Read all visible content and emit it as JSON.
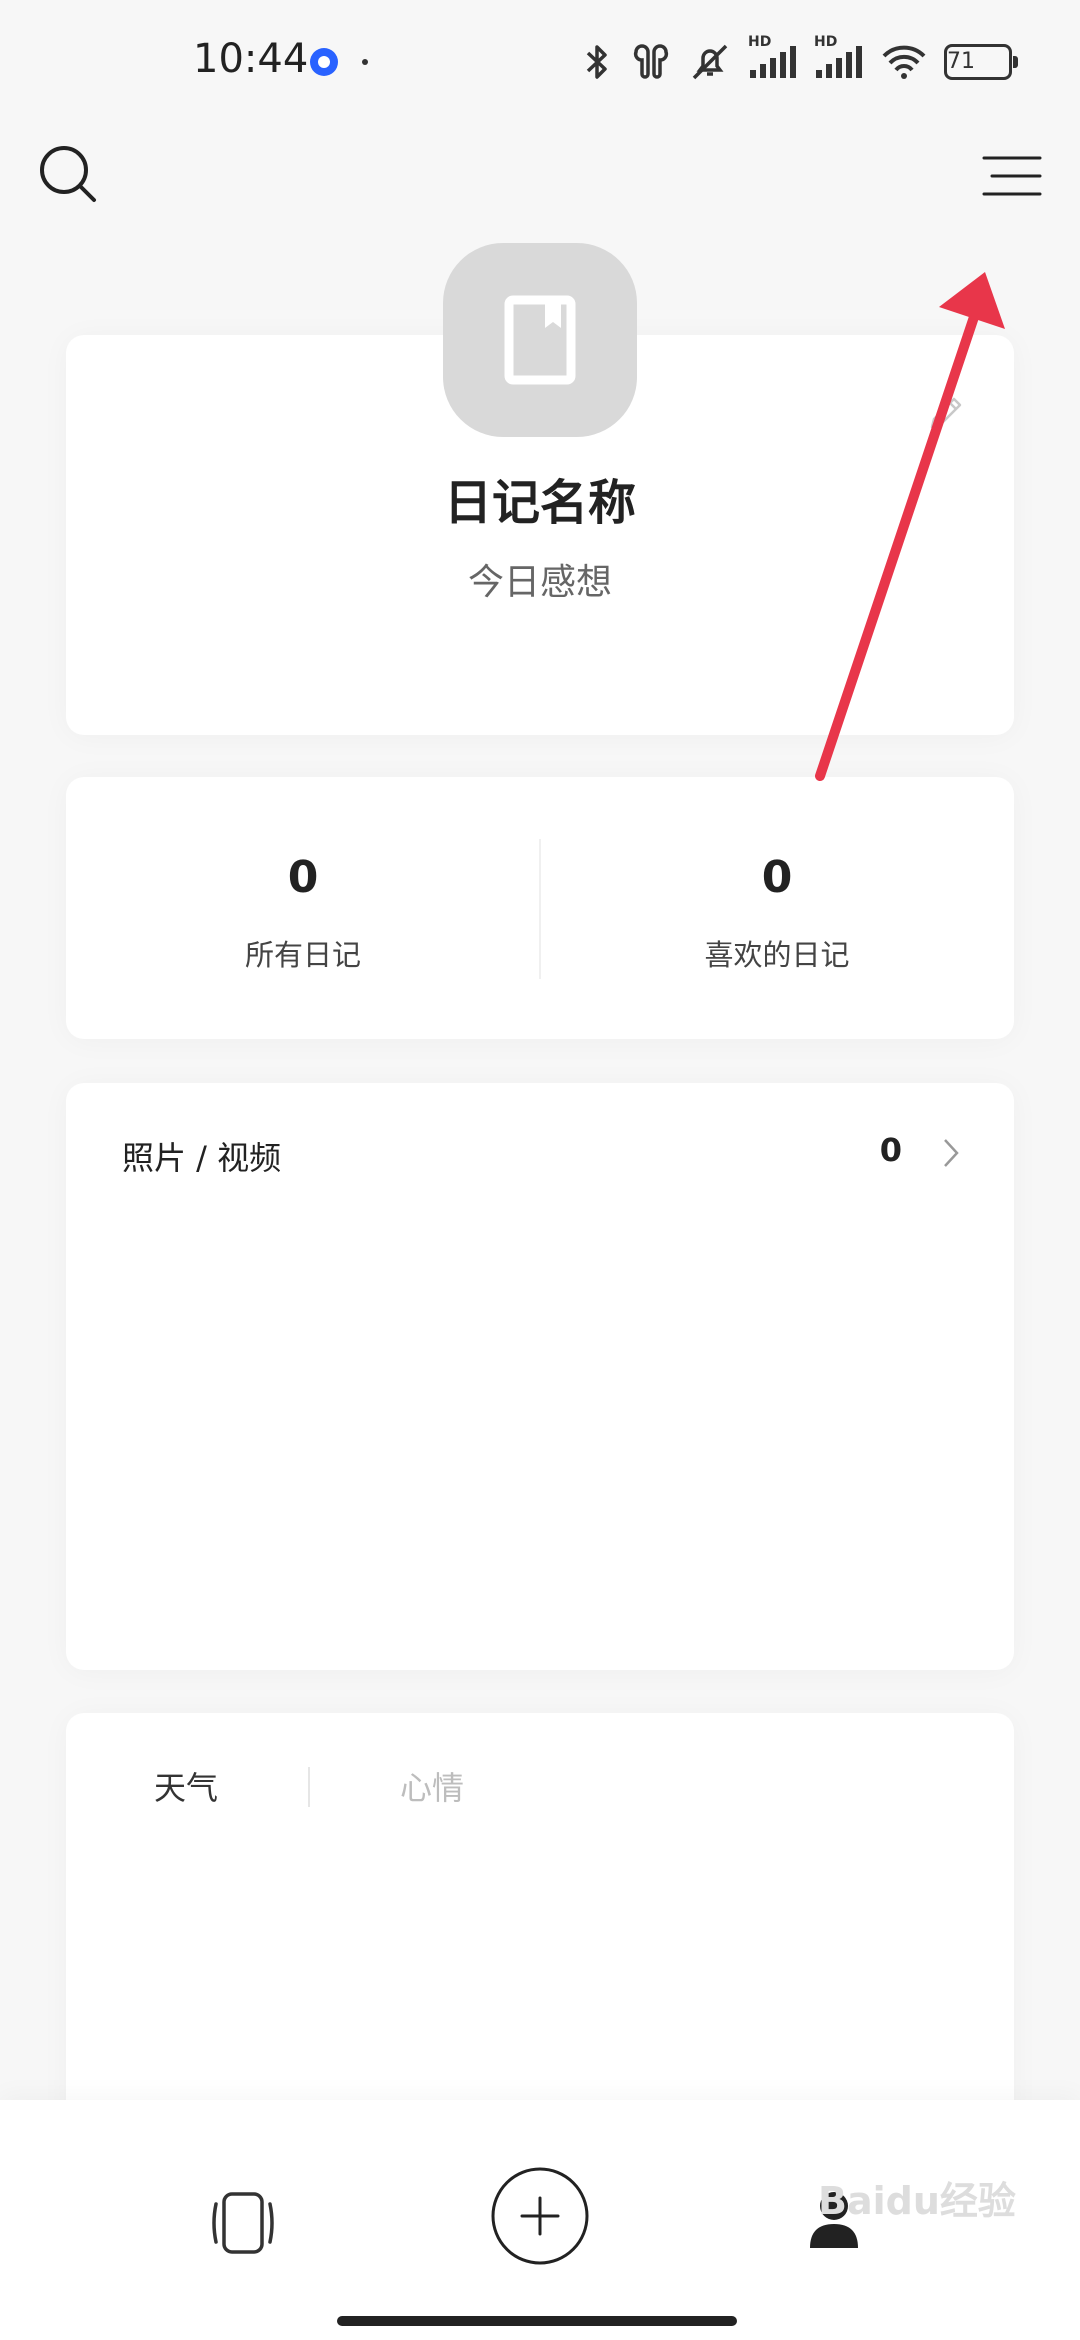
{
  "status_bar": {
    "time": "10:44",
    "battery": "71",
    "network_label_1": "HD",
    "network_label_2": "HD"
  },
  "diary": {
    "name": "日记名称",
    "description": "今日感想"
  },
  "stats": [
    {
      "value": "0",
      "label": "所有日记"
    },
    {
      "value": "0",
      "label": "喜欢的日记"
    }
  ],
  "media": {
    "title": "照片 / 视频",
    "count": "0"
  },
  "tabs": {
    "weather": "天气",
    "mood": "心情"
  },
  "watermark": "Baidu经验",
  "colors": {
    "annotation_arrow": "#e8364a",
    "cover_background": "#d9d9d9",
    "page_background": "#f7f7f7"
  }
}
